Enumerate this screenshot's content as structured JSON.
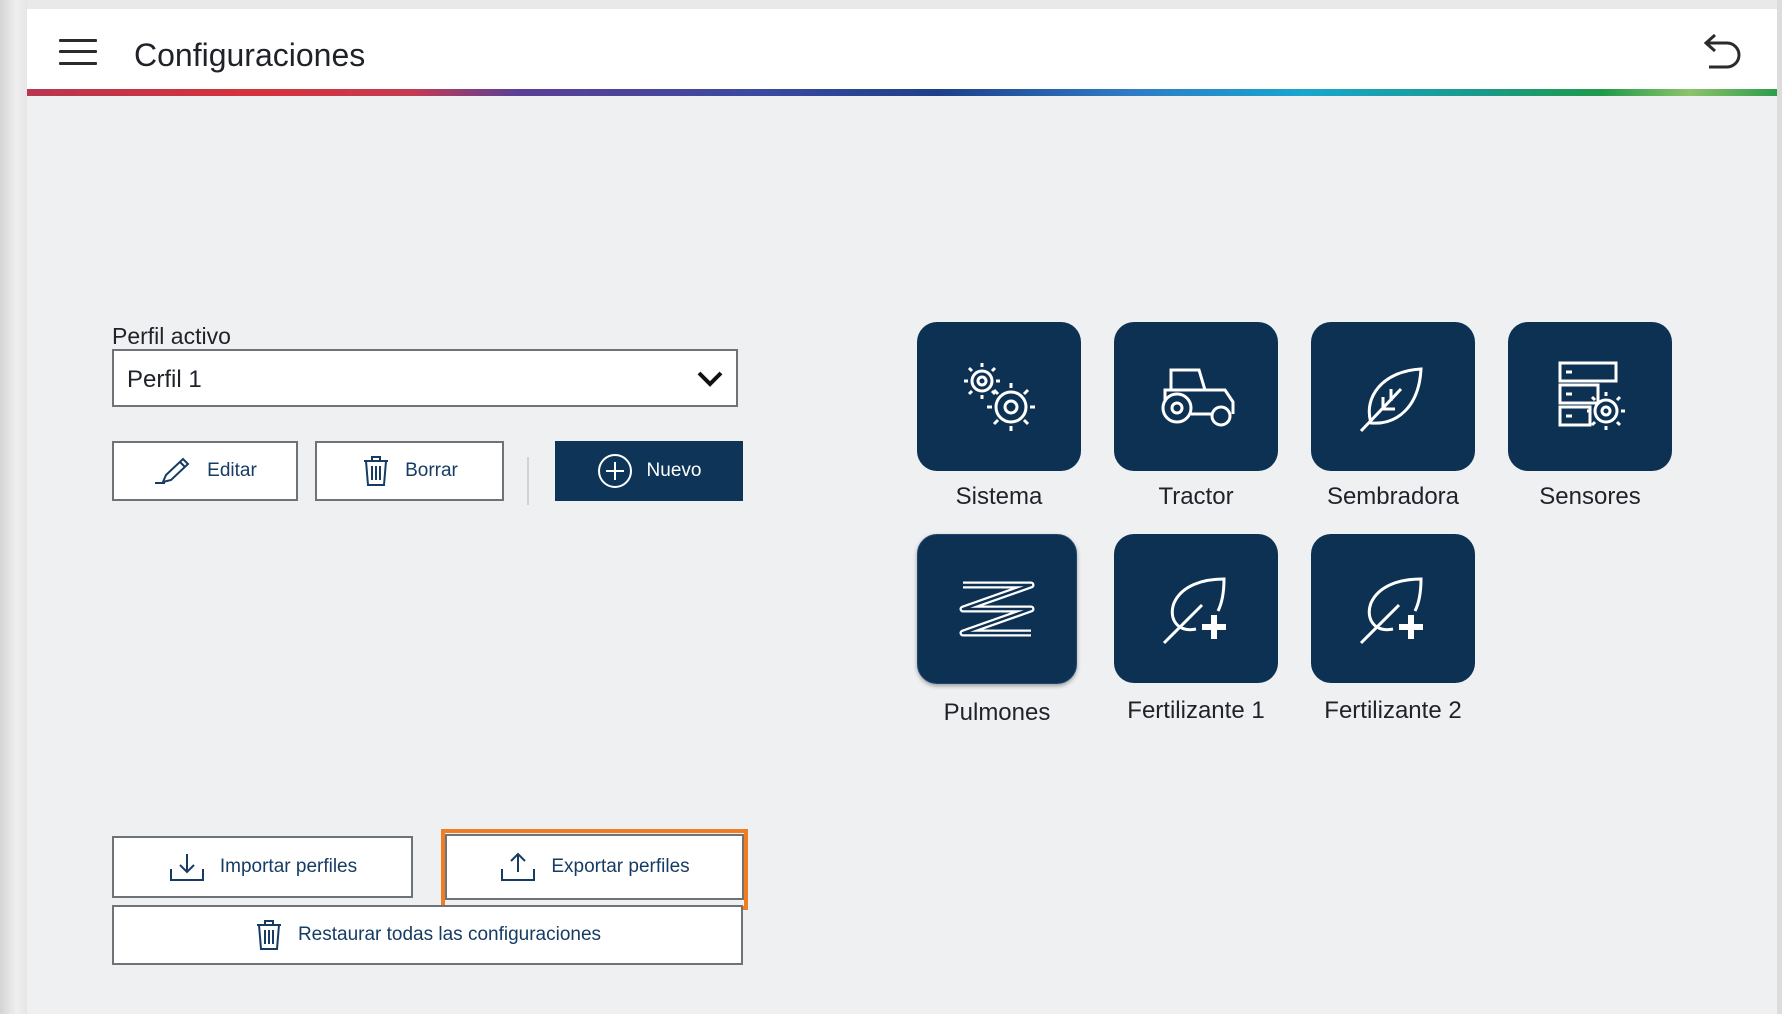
{
  "header": {
    "title": "Configuraciones",
    "menu_icon": "hamburger-menu-icon",
    "back_icon": "undo-arrow-icon"
  },
  "profile": {
    "label": "Perfil activo",
    "selected": "Perfil 1",
    "edit_label": "Editar",
    "delete_label": "Borrar",
    "new_label": "Nuevo"
  },
  "actions": {
    "import_label": "Importar perfiles",
    "export_label": "Exportar perfiles",
    "restore_label": "Restaurar todas las configuraciones"
  },
  "tiles": [
    {
      "label": "Sistema",
      "icon": "gears-icon"
    },
    {
      "label": "Tractor",
      "icon": "tractor-icon"
    },
    {
      "label": "Sembradora",
      "icon": "leaf-icon"
    },
    {
      "label": "Sensores",
      "icon": "server-gear-icon"
    },
    {
      "label": "Pulmones",
      "icon": "zigzag-icon"
    },
    {
      "label": "Fertilizante 1",
      "icon": "leaf-plus-icon"
    },
    {
      "label": "Fertilizante 2",
      "icon": "leaf-plus-icon"
    }
  ],
  "colors": {
    "primary": "#0e3558",
    "tile": "#0d3152",
    "highlight": "#f07d22",
    "background": "#eff0f2",
    "text": "#1f2329"
  }
}
